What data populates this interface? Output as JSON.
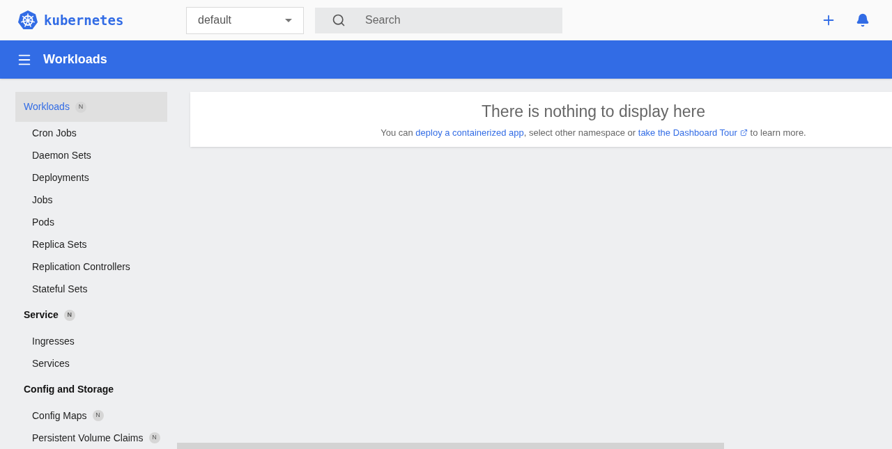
{
  "header": {
    "logo_text": "kubernetes",
    "namespace": {
      "value": "default"
    },
    "search": {
      "placeholder": "Search"
    }
  },
  "toolbar": {
    "title": "Workloads"
  },
  "sidebar": {
    "sections": [
      {
        "label": "Workloads",
        "badge": "N",
        "selected": true,
        "children": [
          {
            "label": "Cron Jobs"
          },
          {
            "label": "Daemon Sets"
          },
          {
            "label": "Deployments"
          },
          {
            "label": "Jobs"
          },
          {
            "label": "Pods"
          },
          {
            "label": "Replica Sets"
          },
          {
            "label": "Replication Controllers"
          },
          {
            "label": "Stateful Sets"
          }
        ]
      },
      {
        "label": "Service",
        "badge": "N",
        "selected": false,
        "children": [
          {
            "label": "Ingresses"
          },
          {
            "label": "Services"
          }
        ]
      },
      {
        "label": "Config and Storage",
        "selected": false,
        "children": [
          {
            "label": "Config Maps",
            "badge": "N"
          },
          {
            "label": "Persistent Volume Claims",
            "badge": "N"
          }
        ]
      }
    ]
  },
  "empty_state": {
    "title": "There is nothing to display here",
    "message": [
      {
        "kind": "text",
        "text": "You can "
      },
      {
        "kind": "link",
        "text": "deploy a containerized app"
      },
      {
        "kind": "text",
        "text": ", select other namespace or "
      },
      {
        "kind": "external-link",
        "text": "take the Dashboard Tour"
      },
      {
        "kind": "text",
        "text": " to learn more."
      }
    ]
  }
}
